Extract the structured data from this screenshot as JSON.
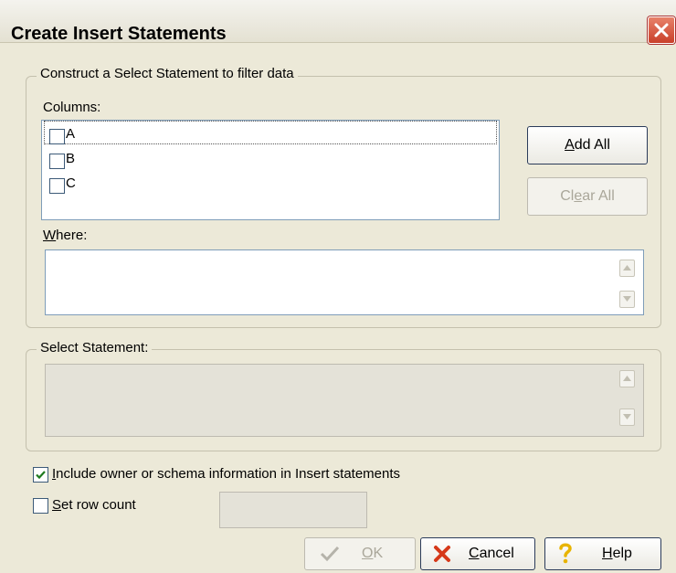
{
  "window": {
    "title": "Create Insert Statements"
  },
  "filter_group": {
    "legend": "Construct a Select Statement to filter data",
    "columns_label": "Columns:",
    "columns": [
      {
        "label": "A",
        "checked": false
      },
      {
        "label": "B",
        "checked": false
      },
      {
        "label": "C",
        "checked": false
      }
    ],
    "add_all": {
      "pre": "",
      "key": "A",
      "post": "dd All"
    },
    "clear_all": {
      "pre": "Cl",
      "key": "e",
      "post": "ar All"
    },
    "where": {
      "key": "W",
      "rest": "here:",
      "value": ""
    }
  },
  "select_group": {
    "legend": "Select Statement:",
    "value": ""
  },
  "include_owner": {
    "key": "I",
    "rest": "nclude owner or schema information in Insert statements",
    "checked": true
  },
  "row_count": {
    "key": "S",
    "rest": "et row count",
    "checked": false,
    "value": ""
  },
  "buttons": {
    "ok": {
      "key": "O",
      "rest": "K",
      "enabled": false
    },
    "cancel": {
      "key": "C",
      "rest": "ancel"
    },
    "help": {
      "key": "H",
      "rest": "elp"
    }
  }
}
